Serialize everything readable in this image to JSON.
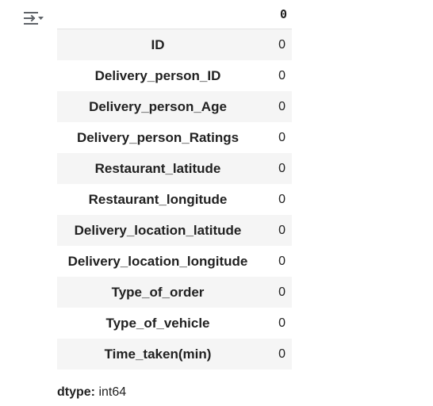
{
  "output_toolbar": {
    "icon": "output-actions-icon"
  },
  "table": {
    "column_header": "0",
    "rows": [
      {
        "label": "ID",
        "value": "0"
      },
      {
        "label": "Delivery_person_ID",
        "value": "0"
      },
      {
        "label": "Delivery_person_Age",
        "value": "0"
      },
      {
        "label": "Delivery_person_Ratings",
        "value": "0"
      },
      {
        "label": "Restaurant_latitude",
        "value": "0"
      },
      {
        "label": "Restaurant_longitude",
        "value": "0"
      },
      {
        "label": "Delivery_location_latitude",
        "value": "0"
      },
      {
        "label": "Delivery_location_longitude",
        "value": "0"
      },
      {
        "label": "Type_of_order",
        "value": "0"
      },
      {
        "label": "Type_of_vehicle",
        "value": "0"
      },
      {
        "label": "Time_taken(min)",
        "value": "0"
      }
    ]
  },
  "dtype": {
    "label": "dtype:",
    "value": "int64"
  }
}
